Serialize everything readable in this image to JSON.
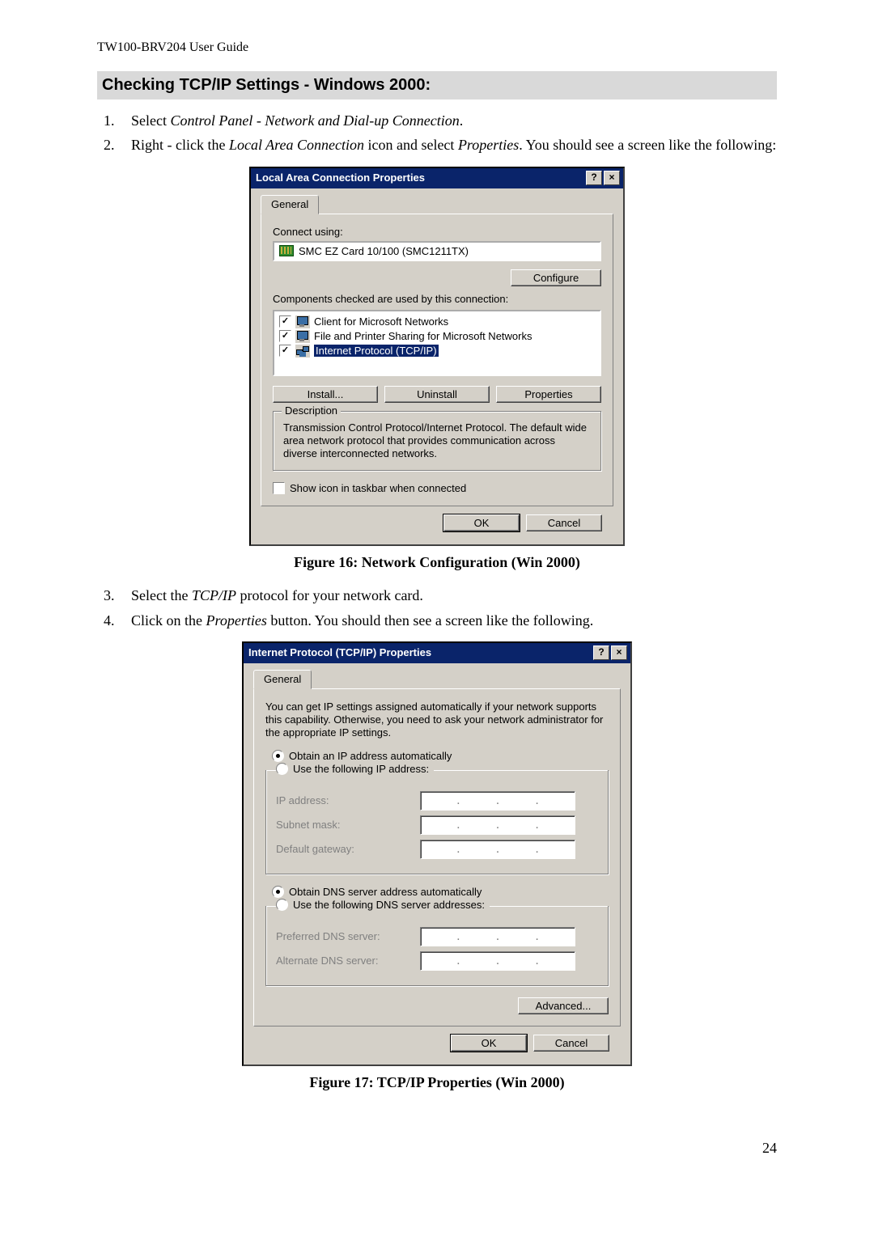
{
  "doc_header": "TW100-BRV204  User Guide",
  "section_heading": "Checking TCP/IP Settings - Windows 2000:",
  "step1_prefix": "Select ",
  "step1_italic": "Control Panel - Network and Dial-up Connection",
  "step1_suffix": ".",
  "step2_prefix": "Right - click the ",
  "step2_italic": "Local Area Connection",
  "step2_mid": " icon and select ",
  "step2_italic2": "Properties",
  "step2_suffix": ". You should see a screen like the following:",
  "figure16_caption": "Figure 16: Network Configuration (Win 2000)",
  "step3_prefix": "Select the ",
  "step3_italic": "TCP/IP",
  "step3_suffix": " protocol for your network card.",
  "step4_prefix": "Click on the ",
  "step4_italic": "Properties",
  "step4_suffix": " button. You should then see a screen like the following.",
  "figure17_caption": "Figure 17: TCP/IP Properties (Win 2000)",
  "page_number": "24",
  "dlg1": {
    "title": "Local Area Connection Properties",
    "tab": "General",
    "connect_using": "Connect using:",
    "adapter": "SMC EZ Card 10/100 (SMC1211TX)",
    "configure_btn": "Configure",
    "components_label": "Components checked are used by this connection:",
    "comp1": "Client for Microsoft Networks",
    "comp2": "File and Printer Sharing for Microsoft Networks",
    "comp3": "Internet Protocol (TCP/IP)",
    "install_btn": "Install...",
    "uninstall_btn": "Uninstall",
    "properties_btn": "Properties",
    "desc_title": "Description",
    "desc_text": "Transmission Control Protocol/Internet Protocol. The default wide area network protocol that provides communication across diverse interconnected networks.",
    "show_icon": "Show icon in taskbar when connected",
    "ok_btn": "OK",
    "cancel_btn": "Cancel"
  },
  "dlg2": {
    "title": "Internet Protocol (TCP/IP) Properties",
    "tab": "General",
    "intro": "You can get IP settings assigned automatically if your network supports this capability. Otherwise, you need to ask your network administrator for the appropriate IP settings.",
    "r_auto_ip": "Obtain an IP address automatically",
    "r_use_ip": "Use the following IP address:",
    "ip_address": "IP address:",
    "subnet": "Subnet mask:",
    "gateway": "Default gateway:",
    "r_auto_dns": "Obtain DNS server address automatically",
    "r_use_dns": "Use the following DNS server addresses:",
    "pref_dns": "Preferred DNS server:",
    "alt_dns": "Alternate DNS server:",
    "advanced_btn": "Advanced...",
    "ok_btn": "OK",
    "cancel_btn": "Cancel"
  }
}
